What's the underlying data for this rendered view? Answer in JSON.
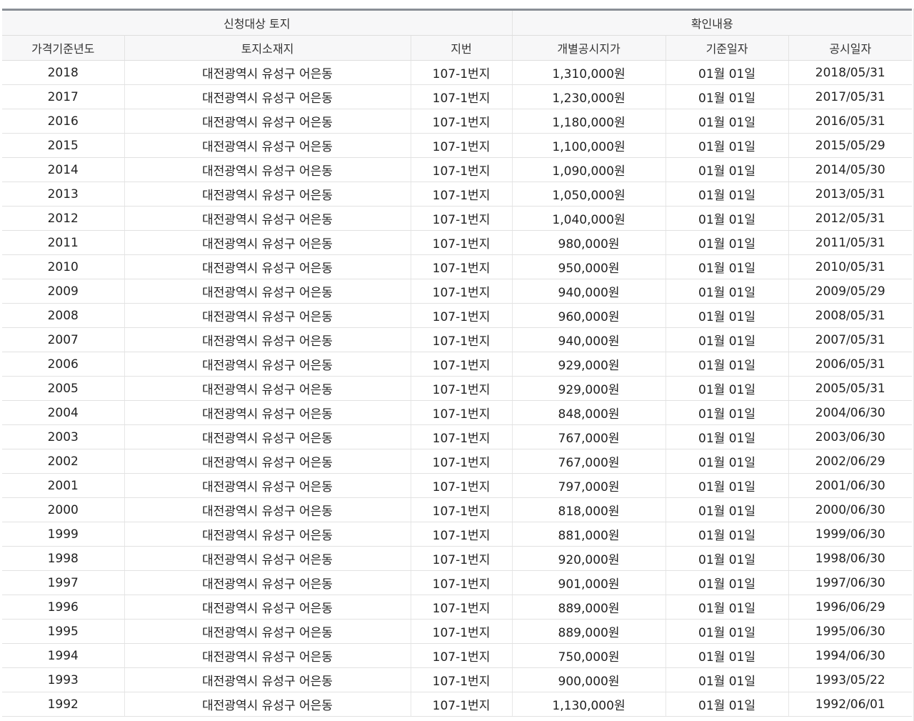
{
  "table": {
    "group_headers": {
      "target_land": "신청대상 토지",
      "confirmation": "확인내용"
    },
    "columns": {
      "year": "가격기준년도",
      "location": "토지소재지",
      "lot_number": "지번",
      "price": "개별공시지가",
      "base_date": "기준일자",
      "notice_date": "공시일자"
    },
    "rows": [
      {
        "year": "2018",
        "location": "대전광역시 유성구 어은동",
        "lot_number": "107-1번지",
        "price": "1,310,000원",
        "base_date": "01월 01일",
        "notice_date": "2018/05/31"
      },
      {
        "year": "2017",
        "location": "대전광역시 유성구 어은동",
        "lot_number": "107-1번지",
        "price": "1,230,000원",
        "base_date": "01월 01일",
        "notice_date": "2017/05/31"
      },
      {
        "year": "2016",
        "location": "대전광역시 유성구 어은동",
        "lot_number": "107-1번지",
        "price": "1,180,000원",
        "base_date": "01월 01일",
        "notice_date": "2016/05/31"
      },
      {
        "year": "2015",
        "location": "대전광역시 유성구 어은동",
        "lot_number": "107-1번지",
        "price": "1,100,000원",
        "base_date": "01월 01일",
        "notice_date": "2015/05/29"
      },
      {
        "year": "2014",
        "location": "대전광역시 유성구 어은동",
        "lot_number": "107-1번지",
        "price": "1,090,000원",
        "base_date": "01월 01일",
        "notice_date": "2014/05/30"
      },
      {
        "year": "2013",
        "location": "대전광역시 유성구 어은동",
        "lot_number": "107-1번지",
        "price": "1,050,000원",
        "base_date": "01월 01일",
        "notice_date": "2013/05/31"
      },
      {
        "year": "2012",
        "location": "대전광역시 유성구 어은동",
        "lot_number": "107-1번지",
        "price": "1,040,000원",
        "base_date": "01월 01일",
        "notice_date": "2012/05/31"
      },
      {
        "year": "2011",
        "location": "대전광역시 유성구 어은동",
        "lot_number": "107-1번지",
        "price": "980,000원",
        "base_date": "01월 01일",
        "notice_date": "2011/05/31"
      },
      {
        "year": "2010",
        "location": "대전광역시 유성구 어은동",
        "lot_number": "107-1번지",
        "price": "950,000원",
        "base_date": "01월 01일",
        "notice_date": "2010/05/31"
      },
      {
        "year": "2009",
        "location": "대전광역시 유성구 어은동",
        "lot_number": "107-1번지",
        "price": "940,000원",
        "base_date": "01월 01일",
        "notice_date": "2009/05/29"
      },
      {
        "year": "2008",
        "location": "대전광역시 유성구 어은동",
        "lot_number": "107-1번지",
        "price": "960,000원",
        "base_date": "01월 01일",
        "notice_date": "2008/05/31"
      },
      {
        "year": "2007",
        "location": "대전광역시 유성구 어은동",
        "lot_number": "107-1번지",
        "price": "940,000원",
        "base_date": "01월 01일",
        "notice_date": "2007/05/31"
      },
      {
        "year": "2006",
        "location": "대전광역시 유성구 어은동",
        "lot_number": "107-1번지",
        "price": "929,000원",
        "base_date": "01월 01일",
        "notice_date": "2006/05/31"
      },
      {
        "year": "2005",
        "location": "대전광역시 유성구 어은동",
        "lot_number": "107-1번지",
        "price": "929,000원",
        "base_date": "01월 01일",
        "notice_date": "2005/05/31"
      },
      {
        "year": "2004",
        "location": "대전광역시 유성구 어은동",
        "lot_number": "107-1번지",
        "price": "848,000원",
        "base_date": "01월 01일",
        "notice_date": "2004/06/30"
      },
      {
        "year": "2003",
        "location": "대전광역시 유성구 어은동",
        "lot_number": "107-1번지",
        "price": "767,000원",
        "base_date": "01월 01일",
        "notice_date": "2003/06/30"
      },
      {
        "year": "2002",
        "location": "대전광역시 유성구 어은동",
        "lot_number": "107-1번지",
        "price": "767,000원",
        "base_date": "01월 01일",
        "notice_date": "2002/06/29"
      },
      {
        "year": "2001",
        "location": "대전광역시 유성구 어은동",
        "lot_number": "107-1번지",
        "price": "797,000원",
        "base_date": "01월 01일",
        "notice_date": "2001/06/30"
      },
      {
        "year": "2000",
        "location": "대전광역시 유성구 어은동",
        "lot_number": "107-1번지",
        "price": "818,000원",
        "base_date": "01월 01일",
        "notice_date": "2000/06/30"
      },
      {
        "year": "1999",
        "location": "대전광역시 유성구 어은동",
        "lot_number": "107-1번지",
        "price": "881,000원",
        "base_date": "01월 01일",
        "notice_date": "1999/06/30"
      },
      {
        "year": "1998",
        "location": "대전광역시 유성구 어은동",
        "lot_number": "107-1번지",
        "price": "920,000원",
        "base_date": "01월 01일",
        "notice_date": "1998/06/30"
      },
      {
        "year": "1997",
        "location": "대전광역시 유성구 어은동",
        "lot_number": "107-1번지",
        "price": "901,000원",
        "base_date": "01월 01일",
        "notice_date": "1997/06/30"
      },
      {
        "year": "1996",
        "location": "대전광역시 유성구 어은동",
        "lot_number": "107-1번지",
        "price": "889,000원",
        "base_date": "01월 01일",
        "notice_date": "1996/06/29"
      },
      {
        "year": "1995",
        "location": "대전광역시 유성구 어은동",
        "lot_number": "107-1번지",
        "price": "889,000원",
        "base_date": "01월 01일",
        "notice_date": "1995/06/30"
      },
      {
        "year": "1994",
        "location": "대전광역시 유성구 어은동",
        "lot_number": "107-1번지",
        "price": "750,000원",
        "base_date": "01월 01일",
        "notice_date": "1994/06/30"
      },
      {
        "year": "1993",
        "location": "대전광역시 유성구 어은동",
        "lot_number": "107-1번지",
        "price": "900,000원",
        "base_date": "01월 01일",
        "notice_date": "1993/05/22"
      },
      {
        "year": "1992",
        "location": "대전광역시 유성구 어은동",
        "lot_number": "107-1번지",
        "price": "1,130,000원",
        "base_date": "01월 01일",
        "notice_date": "1992/06/01"
      }
    ]
  }
}
